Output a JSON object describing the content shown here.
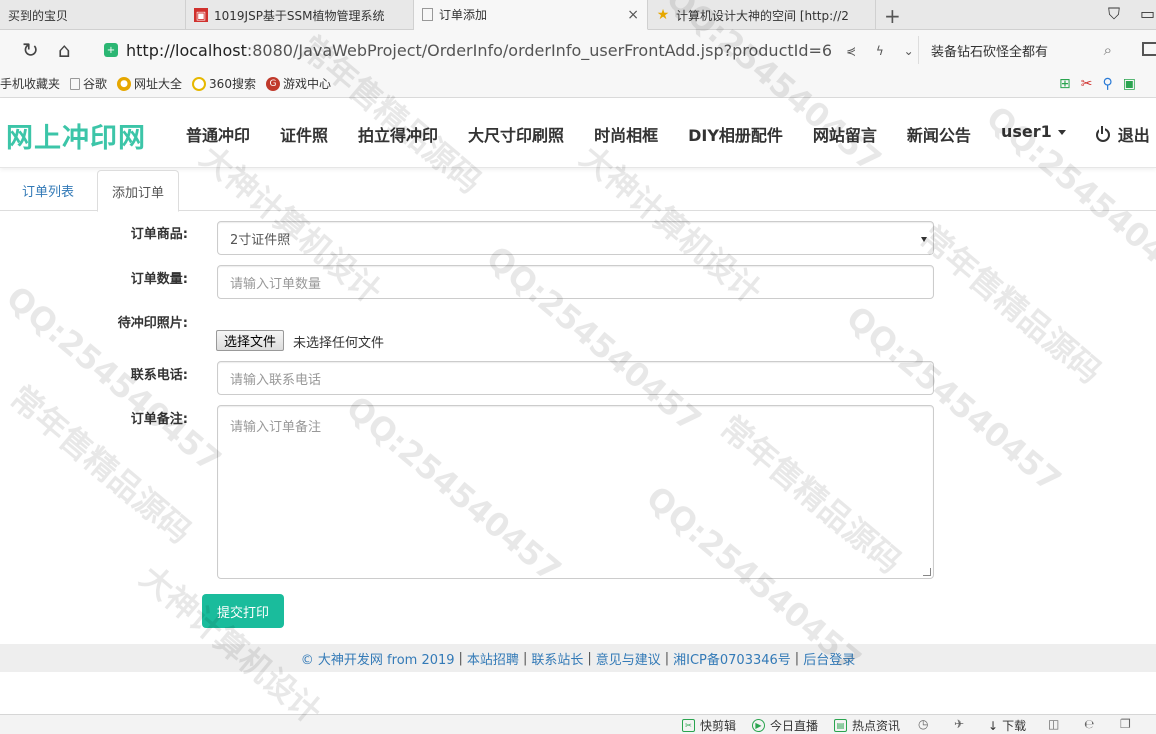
{
  "browser": {
    "tabs": [
      {
        "title": "买到的宝贝"
      },
      {
        "title": "1019JSP基于SSM植物管理系统"
      },
      {
        "title": "订单添加",
        "close": "×"
      },
      {
        "title": "计算机设计大神的空间 [http://2"
      }
    ],
    "url_host": "http://localhost",
    "url_path": ":8080/JavaWebProject/OrderInfo/orderInfo_userFrontAdd.jsp?productId=6",
    "search_text": "装备钻石砍怪全都有",
    "bookmarks": [
      "手机收藏夹",
      "谷歌",
      "网址大全",
      "360搜索",
      "游戏中心"
    ]
  },
  "site": {
    "brand": "网上冲印网",
    "nav": [
      "普通冲印",
      "证件照",
      "拍立得冲印",
      "大尺寸印刷照",
      "时尚相框",
      "DIY相册配件",
      "网站留言",
      "新闻公告"
    ],
    "user": "user1",
    "logout": "退出",
    "accent": "#1abc9c"
  },
  "tabs": {
    "list": "订单列表",
    "add": "添加订单"
  },
  "form": {
    "product_label": "订单商品:",
    "product_value": "2寸证件照",
    "qty_label": "订单数量:",
    "qty_placeholder": "请输入订单数量",
    "photo_label": "待冲印照片:",
    "file_button": "选择文件",
    "file_status": "未选择任何文件",
    "phone_label": "联系电话:",
    "phone_placeholder": "请输入联系电话",
    "memo_label": "订单备注:",
    "memo_placeholder": "请输入订单备注",
    "submit": "提交打印"
  },
  "footer": {
    "copyright": "© 大神开发网 from 2019",
    "links": [
      "本站招聘",
      "联系站长",
      "意见与建议",
      "湘ICP备0703346号",
      "后台登录"
    ]
  },
  "statusbar": [
    "快剪辑",
    "今日直播",
    "热点资讯",
    "下载"
  ],
  "watermark": [
    "QQ:254540457",
    "大神计算机设计",
    "常年售精品源码"
  ]
}
